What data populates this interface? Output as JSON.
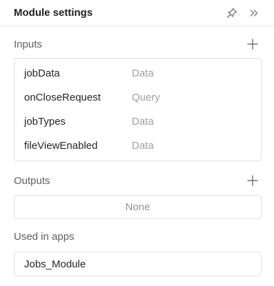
{
  "header": {
    "title": "Module settings",
    "pin_icon": "pin-icon",
    "collapse_icon": "double-chevron-right-icon"
  },
  "inputs": {
    "label": "Inputs",
    "add_icon": "plus-icon",
    "items": [
      {
        "name": "jobData",
        "type": "Data"
      },
      {
        "name": "onCloseRequest",
        "type": "Query"
      },
      {
        "name": "jobTypes",
        "type": "Data"
      },
      {
        "name": "fileViewEnabled",
        "type": "Data"
      }
    ]
  },
  "outputs": {
    "label": "Outputs",
    "add_icon": "plus-icon",
    "empty_text": "None"
  },
  "used_in_apps": {
    "label": "Used in apps",
    "apps": [
      "Jobs_Module"
    ]
  }
}
